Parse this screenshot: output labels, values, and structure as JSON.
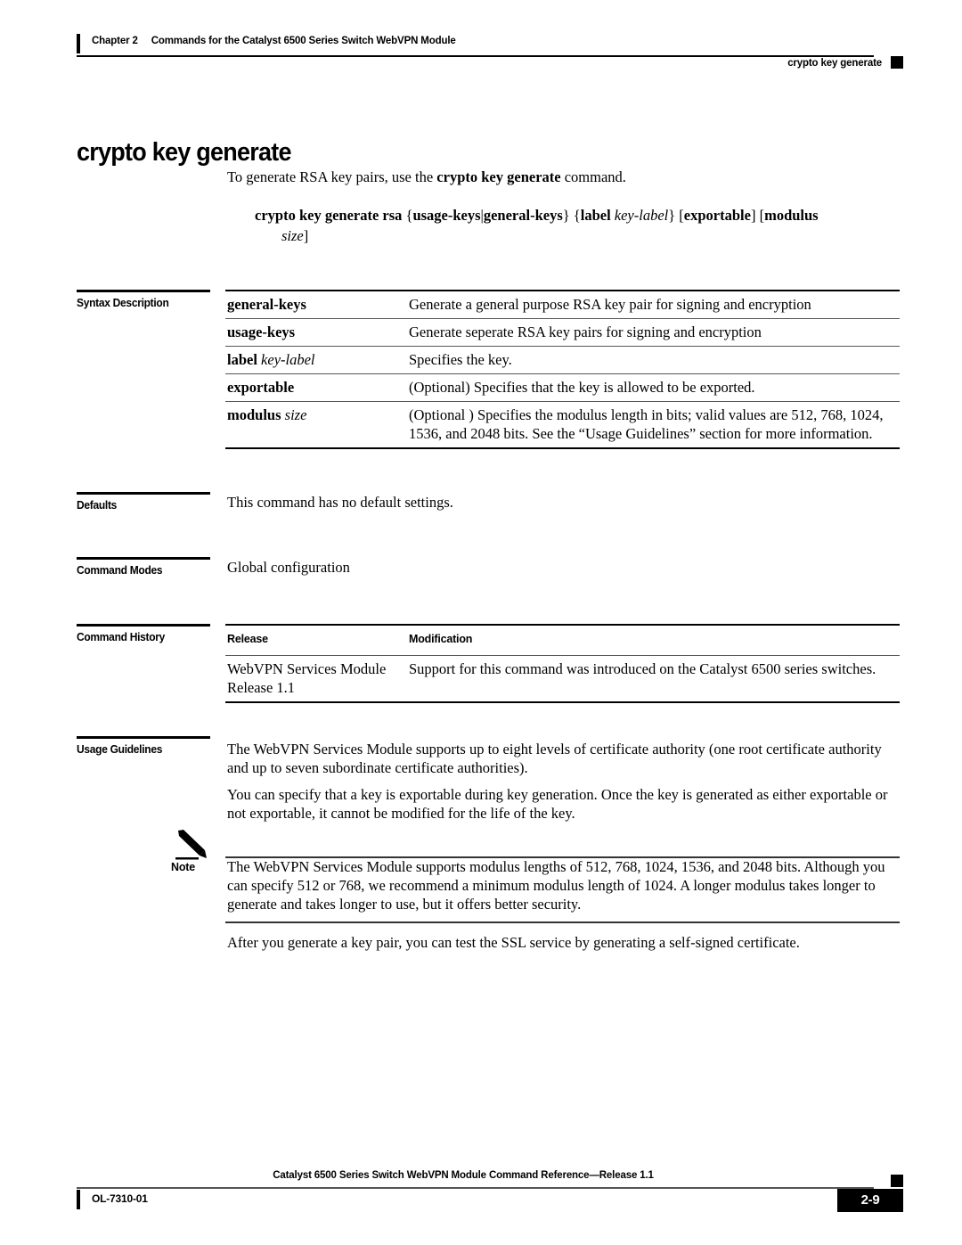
{
  "header": {
    "chapter": "Chapter 2",
    "chapter_title": "Commands for the Catalyst 6500 Series Switch WebVPN Module",
    "running_head": "crypto key generate"
  },
  "title": "crypto key generate",
  "intro": {
    "prefix": "To generate RSA key pairs, use the ",
    "command": "crypto key generate",
    "suffix": " command."
  },
  "syntax": {
    "line1_bold_a": "crypto key generate rsa",
    "line1_brace_open": " {",
    "line1_bold_b": "usage-keys",
    "line1_pipe": "|",
    "line1_bold_c": "general-keys",
    "line1_brace_close": "} {",
    "line1_bold_d": "label",
    "line1_ital_a": " key-label",
    "line1_brace_close2": "} [",
    "line1_bold_e": "exportable",
    "line1_brack_close": "] [",
    "line1_bold_f": "modulus",
    "line2_ital": "size",
    "line2_close": "]"
  },
  "sections": {
    "syntax_description": "Syntax Description",
    "defaults": "Defaults",
    "command_modes": "Command Modes",
    "command_history": "Command History",
    "usage_guidelines": "Usage Guidelines"
  },
  "syntax_table": [
    {
      "term_bold": "general-keys",
      "term_ital": "",
      "desc": "Generate a general purpose RSA key pair for signing and encryption"
    },
    {
      "term_bold": "usage-keys",
      "term_ital": "",
      "desc": "Generate seperate RSA key pairs for signing and encryption"
    },
    {
      "term_bold": "label",
      "term_ital": " key-label",
      "desc": "Specifies the key."
    },
    {
      "term_bold": "exportable",
      "term_ital": "",
      "desc": "(Optional) Specifies that the key is allowed to be exported."
    },
    {
      "term_bold": "modulus",
      "term_ital": " size",
      "desc": "(Optional ) Specifies the modulus length in bits; valid values are 512, 768, 1024, 1536, and 2048 bits. See the “Usage Guidelines” section for more information."
    }
  ],
  "defaults_text": "This command has no default settings.",
  "command_modes_text": "Global configuration",
  "command_history": {
    "headers": [
      "Release",
      "Modification"
    ],
    "rows": [
      {
        "release": "WebVPN Services Module Release 1.1",
        "modification": "Support for this command was introduced on the Catalyst 6500 series switches."
      }
    ]
  },
  "usage_guidelines": {
    "p1": "The WebVPN Services Module supports up to eight levels of certificate authority (one root certificate authority and up to seven subordinate certificate authorities).",
    "p2": "You can specify that a key is exportable during key generation. Once the key is generated as either exportable or not exportable, it cannot be modified for the life of the key."
  },
  "note": {
    "label": "Note",
    "text": "The WebVPN Services Module supports modulus lengths of 512, 768, 1024, 1536, and 2048 bits. Although you can specify 512 or 768, we recommend a minimum modulus length of 1024. A longer modulus takes longer to generate and takes longer to use, but it offers better security."
  },
  "closing_text": "After you generate a key pair, you can test the SSL service by generating a self-signed certificate.",
  "footer": {
    "center": "Catalyst 6500 Series Switch WebVPN Module Command Reference—Release 1.1",
    "doc_number": "OL-7310-01",
    "page_number": "2-9"
  },
  "colors": {
    "ink": "#000000",
    "rule": "#555555",
    "paper": "#ffffff"
  }
}
